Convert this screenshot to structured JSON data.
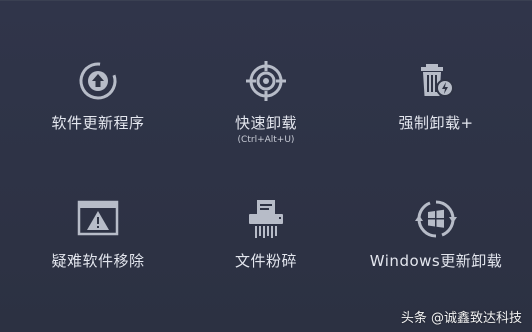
{
  "tiles": [
    {
      "label": "软件更新程序",
      "icon": "update-arrow-circle-icon"
    },
    {
      "label": "快速卸载",
      "sub": "(Ctrl+Alt+U)",
      "icon": "crosshair-target-icon"
    },
    {
      "label": "强制卸载+",
      "icon": "trash-lightning-icon"
    },
    {
      "label": "疑难软件移除",
      "icon": "warning-window-icon"
    },
    {
      "label": "文件粉碎",
      "icon": "shredder-icon"
    },
    {
      "label": "Windows更新卸载",
      "icon": "windows-refresh-icon"
    }
  ],
  "watermark": "头条 @诚鑫致达科技",
  "colors": {
    "background": "#2d3240",
    "icon": "#b7bcc8",
    "text": "#e3e6ee"
  }
}
